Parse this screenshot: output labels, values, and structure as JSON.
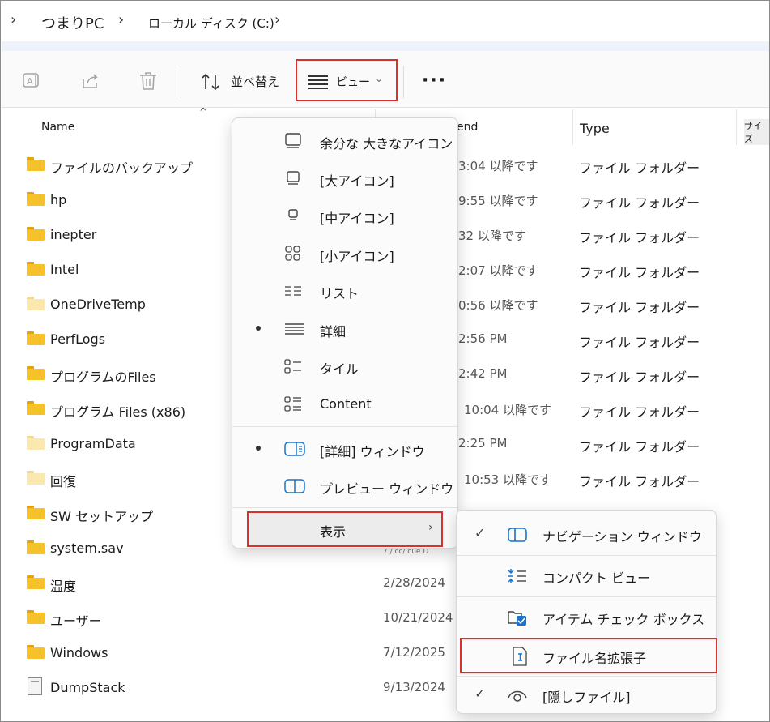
{
  "breadcrumb": [
    "つまりPC",
    "ローカル ディスク (C:)"
  ],
  "toolbar": {
    "sort_label": "並べ替え",
    "view_label": "ビュー"
  },
  "columns": {
    "name": "Name",
    "date_partial": "end",
    "type": "Type",
    "size": "サイズ"
  },
  "files": [
    {
      "name": "ファイルのバックアップ",
      "date": "3:04 以降です",
      "type": "ファイル フォルダー",
      "icon": "folder"
    },
    {
      "name": "hp",
      "date": "9:55 以降です",
      "type": "ファイル フォルダー",
      "icon": "folder"
    },
    {
      "name": "inepter",
      "date": "32 以降です",
      "type": "ファイル フォルダー",
      "icon": "folder"
    },
    {
      "name": "Intel",
      "date": "2:07 以降です",
      "type": "ファイル フォルダー",
      "icon": "folder"
    },
    {
      "name": "OneDriveTemp",
      "date": "0:56 以降です",
      "type": "ファイル フォルダー",
      "icon": "folder-pale"
    },
    {
      "name": "PerfLogs",
      "date": "2:56 PM",
      "type": "ファイル フォルダー",
      "icon": "folder"
    },
    {
      "name": "プログラムのFiles",
      "date": "2:42 PM",
      "type": "ファイル フォルダー",
      "icon": "folder"
    },
    {
      "name": "プログラム Files (x86)",
      "date": "10:04 以降です",
      "type": "ファイル フォルダー",
      "icon": "folder"
    },
    {
      "name": "ProgramData",
      "date": "2:25 PM",
      "type": "ファイル フォルダー",
      "icon": "folder-pale"
    },
    {
      "name": "回復",
      "date": "10:53 以降です",
      "type": "ファイル フォルダー",
      "icon": "folder-pale"
    },
    {
      "name": "SW セットアップ",
      "date": "",
      "type": "",
      "icon": "folder"
    },
    {
      "name": "system.sav",
      "date": "",
      "type": "",
      "icon": "folder"
    },
    {
      "name": "温度",
      "date": "2/28/2024",
      "type": "",
      "icon": "folder"
    },
    {
      "name": "ユーザー",
      "date": "10/21/2024",
      "type": "",
      "icon": "folder"
    },
    {
      "name": "Windows",
      "date": "7/12/2025",
      "type": "",
      "icon": "folder"
    },
    {
      "name": "DumpStack",
      "date": "9/13/2024",
      "type": "",
      "icon": "document"
    }
  ],
  "view_menu": {
    "items": [
      {
        "label": "余分な 大きなアイコン",
        "icon": "xl-icon",
        "selected": false
      },
      {
        "label": "[大アイコン]",
        "icon": "large-icon",
        "selected": false
      },
      {
        "label": "[中アイコン]",
        "icon": "medium-icon",
        "selected": false
      },
      {
        "label": "[小アイコン]",
        "icon": "small-icons-icon",
        "selected": false
      },
      {
        "label": "リスト",
        "icon": "list-icon",
        "selected": false
      },
      {
        "label": "詳細",
        "icon": "details-icon",
        "selected": true
      },
      {
        "label": "タイル",
        "icon": "tiles-icon",
        "selected": false
      },
      {
        "label": "Content",
        "icon": "content-icon",
        "selected": false
      }
    ],
    "panes": [
      {
        "label": "[詳細] ウィンドウ",
        "icon": "details-pane-icon",
        "selected": true
      },
      {
        "label": "プレビュー ウィンドウ",
        "icon": "preview-pane-icon",
        "selected": false
      }
    ],
    "show_label": "表示"
  },
  "show_menu": {
    "items": [
      {
        "label": "ナビゲーション ウィンドウ",
        "checked": true
      },
      {
        "label": "コンパクト ビュー",
        "checked": false
      },
      {
        "label": "アイテム チェック ボックス",
        "checked": false
      },
      {
        "label": "ファイル名拡張子",
        "checked": false
      },
      {
        "label": "[隠しファイル]",
        "checked": true
      }
    ]
  },
  "artifact_text": "7 / cc/ cue D",
  "colors": {
    "highlight": "#d9312d",
    "folder": "#f6c22c",
    "accent": "#1a73c8"
  }
}
